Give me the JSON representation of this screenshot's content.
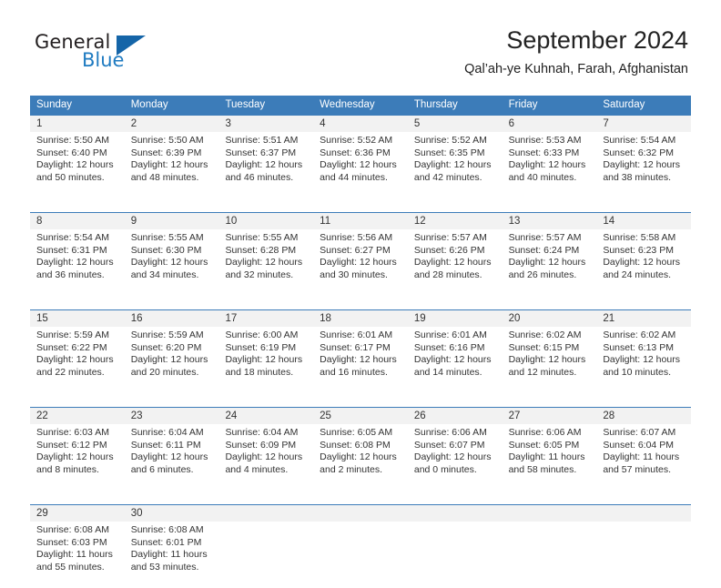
{
  "brand": {
    "name_part1": "General",
    "name_part2": "Blue",
    "logo_icon": "triangle-logo-icon"
  },
  "header": {
    "title": "September 2024",
    "location": "Qal’ah-ye Kuhnah, Farah, Afghanistan"
  },
  "colors": {
    "header_blue": "#3c7cb9",
    "daynum_band": "#f2f2f2",
    "brand_blue": "#1f7bc1",
    "text": "#333333"
  },
  "weekdays": [
    "Sunday",
    "Monday",
    "Tuesday",
    "Wednesday",
    "Thursday",
    "Friday",
    "Saturday"
  ],
  "weeks": [
    [
      {
        "day": "1",
        "sunrise": "Sunrise: 5:50 AM",
        "sunset": "Sunset: 6:40 PM",
        "daylight1": "Daylight: 12 hours",
        "daylight2": "and 50 minutes."
      },
      {
        "day": "2",
        "sunrise": "Sunrise: 5:50 AM",
        "sunset": "Sunset: 6:39 PM",
        "daylight1": "Daylight: 12 hours",
        "daylight2": "and 48 minutes."
      },
      {
        "day": "3",
        "sunrise": "Sunrise: 5:51 AM",
        "sunset": "Sunset: 6:37 PM",
        "daylight1": "Daylight: 12 hours",
        "daylight2": "and 46 minutes."
      },
      {
        "day": "4",
        "sunrise": "Sunrise: 5:52 AM",
        "sunset": "Sunset: 6:36 PM",
        "daylight1": "Daylight: 12 hours",
        "daylight2": "and 44 minutes."
      },
      {
        "day": "5",
        "sunrise": "Sunrise: 5:52 AM",
        "sunset": "Sunset: 6:35 PM",
        "daylight1": "Daylight: 12 hours",
        "daylight2": "and 42 minutes."
      },
      {
        "day": "6",
        "sunrise": "Sunrise: 5:53 AM",
        "sunset": "Sunset: 6:33 PM",
        "daylight1": "Daylight: 12 hours",
        "daylight2": "and 40 minutes."
      },
      {
        "day": "7",
        "sunrise": "Sunrise: 5:54 AM",
        "sunset": "Sunset: 6:32 PM",
        "daylight1": "Daylight: 12 hours",
        "daylight2": "and 38 minutes."
      }
    ],
    [
      {
        "day": "8",
        "sunrise": "Sunrise: 5:54 AM",
        "sunset": "Sunset: 6:31 PM",
        "daylight1": "Daylight: 12 hours",
        "daylight2": "and 36 minutes."
      },
      {
        "day": "9",
        "sunrise": "Sunrise: 5:55 AM",
        "sunset": "Sunset: 6:30 PM",
        "daylight1": "Daylight: 12 hours",
        "daylight2": "and 34 minutes."
      },
      {
        "day": "10",
        "sunrise": "Sunrise: 5:55 AM",
        "sunset": "Sunset: 6:28 PM",
        "daylight1": "Daylight: 12 hours",
        "daylight2": "and 32 minutes."
      },
      {
        "day": "11",
        "sunrise": "Sunrise: 5:56 AM",
        "sunset": "Sunset: 6:27 PM",
        "daylight1": "Daylight: 12 hours",
        "daylight2": "and 30 minutes."
      },
      {
        "day": "12",
        "sunrise": "Sunrise: 5:57 AM",
        "sunset": "Sunset: 6:26 PM",
        "daylight1": "Daylight: 12 hours",
        "daylight2": "and 28 minutes."
      },
      {
        "day": "13",
        "sunrise": "Sunrise: 5:57 AM",
        "sunset": "Sunset: 6:24 PM",
        "daylight1": "Daylight: 12 hours",
        "daylight2": "and 26 minutes."
      },
      {
        "day": "14",
        "sunrise": "Sunrise: 5:58 AM",
        "sunset": "Sunset: 6:23 PM",
        "daylight1": "Daylight: 12 hours",
        "daylight2": "and 24 minutes."
      }
    ],
    [
      {
        "day": "15",
        "sunrise": "Sunrise: 5:59 AM",
        "sunset": "Sunset: 6:22 PM",
        "daylight1": "Daylight: 12 hours",
        "daylight2": "and 22 minutes."
      },
      {
        "day": "16",
        "sunrise": "Sunrise: 5:59 AM",
        "sunset": "Sunset: 6:20 PM",
        "daylight1": "Daylight: 12 hours",
        "daylight2": "and 20 minutes."
      },
      {
        "day": "17",
        "sunrise": "Sunrise: 6:00 AM",
        "sunset": "Sunset: 6:19 PM",
        "daylight1": "Daylight: 12 hours",
        "daylight2": "and 18 minutes."
      },
      {
        "day": "18",
        "sunrise": "Sunrise: 6:01 AM",
        "sunset": "Sunset: 6:17 PM",
        "daylight1": "Daylight: 12 hours",
        "daylight2": "and 16 minutes."
      },
      {
        "day": "19",
        "sunrise": "Sunrise: 6:01 AM",
        "sunset": "Sunset: 6:16 PM",
        "daylight1": "Daylight: 12 hours",
        "daylight2": "and 14 minutes."
      },
      {
        "day": "20",
        "sunrise": "Sunrise: 6:02 AM",
        "sunset": "Sunset: 6:15 PM",
        "daylight1": "Daylight: 12 hours",
        "daylight2": "and 12 minutes."
      },
      {
        "day": "21",
        "sunrise": "Sunrise: 6:02 AM",
        "sunset": "Sunset: 6:13 PM",
        "daylight1": "Daylight: 12 hours",
        "daylight2": "and 10 minutes."
      }
    ],
    [
      {
        "day": "22",
        "sunrise": "Sunrise: 6:03 AM",
        "sunset": "Sunset: 6:12 PM",
        "daylight1": "Daylight: 12 hours",
        "daylight2": "and 8 minutes."
      },
      {
        "day": "23",
        "sunrise": "Sunrise: 6:04 AM",
        "sunset": "Sunset: 6:11 PM",
        "daylight1": "Daylight: 12 hours",
        "daylight2": "and 6 minutes."
      },
      {
        "day": "24",
        "sunrise": "Sunrise: 6:04 AM",
        "sunset": "Sunset: 6:09 PM",
        "daylight1": "Daylight: 12 hours",
        "daylight2": "and 4 minutes."
      },
      {
        "day": "25",
        "sunrise": "Sunrise: 6:05 AM",
        "sunset": "Sunset: 6:08 PM",
        "daylight1": "Daylight: 12 hours",
        "daylight2": "and 2 minutes."
      },
      {
        "day": "26",
        "sunrise": "Sunrise: 6:06 AM",
        "sunset": "Sunset: 6:07 PM",
        "daylight1": "Daylight: 12 hours",
        "daylight2": "and 0 minutes."
      },
      {
        "day": "27",
        "sunrise": "Sunrise: 6:06 AM",
        "sunset": "Sunset: 6:05 PM",
        "daylight1": "Daylight: 11 hours",
        "daylight2": "and 58 minutes."
      },
      {
        "day": "28",
        "sunrise": "Sunrise: 6:07 AM",
        "sunset": "Sunset: 6:04 PM",
        "daylight1": "Daylight: 11 hours",
        "daylight2": "and 57 minutes."
      }
    ],
    [
      {
        "day": "29",
        "sunrise": "Sunrise: 6:08 AM",
        "sunset": "Sunset: 6:03 PM",
        "daylight1": "Daylight: 11 hours",
        "daylight2": "and 55 minutes."
      },
      {
        "day": "30",
        "sunrise": "Sunrise: 6:08 AM",
        "sunset": "Sunset: 6:01 PM",
        "daylight1": "Daylight: 11 hours",
        "daylight2": "and 53 minutes."
      },
      {
        "day": "",
        "sunrise": "",
        "sunset": "",
        "daylight1": "",
        "daylight2": ""
      },
      {
        "day": "",
        "sunrise": "",
        "sunset": "",
        "daylight1": "",
        "daylight2": ""
      },
      {
        "day": "",
        "sunrise": "",
        "sunset": "",
        "daylight1": "",
        "daylight2": ""
      },
      {
        "day": "",
        "sunrise": "",
        "sunset": "",
        "daylight1": "",
        "daylight2": ""
      },
      {
        "day": "",
        "sunrise": "",
        "sunset": "",
        "daylight1": "",
        "daylight2": ""
      }
    ]
  ]
}
